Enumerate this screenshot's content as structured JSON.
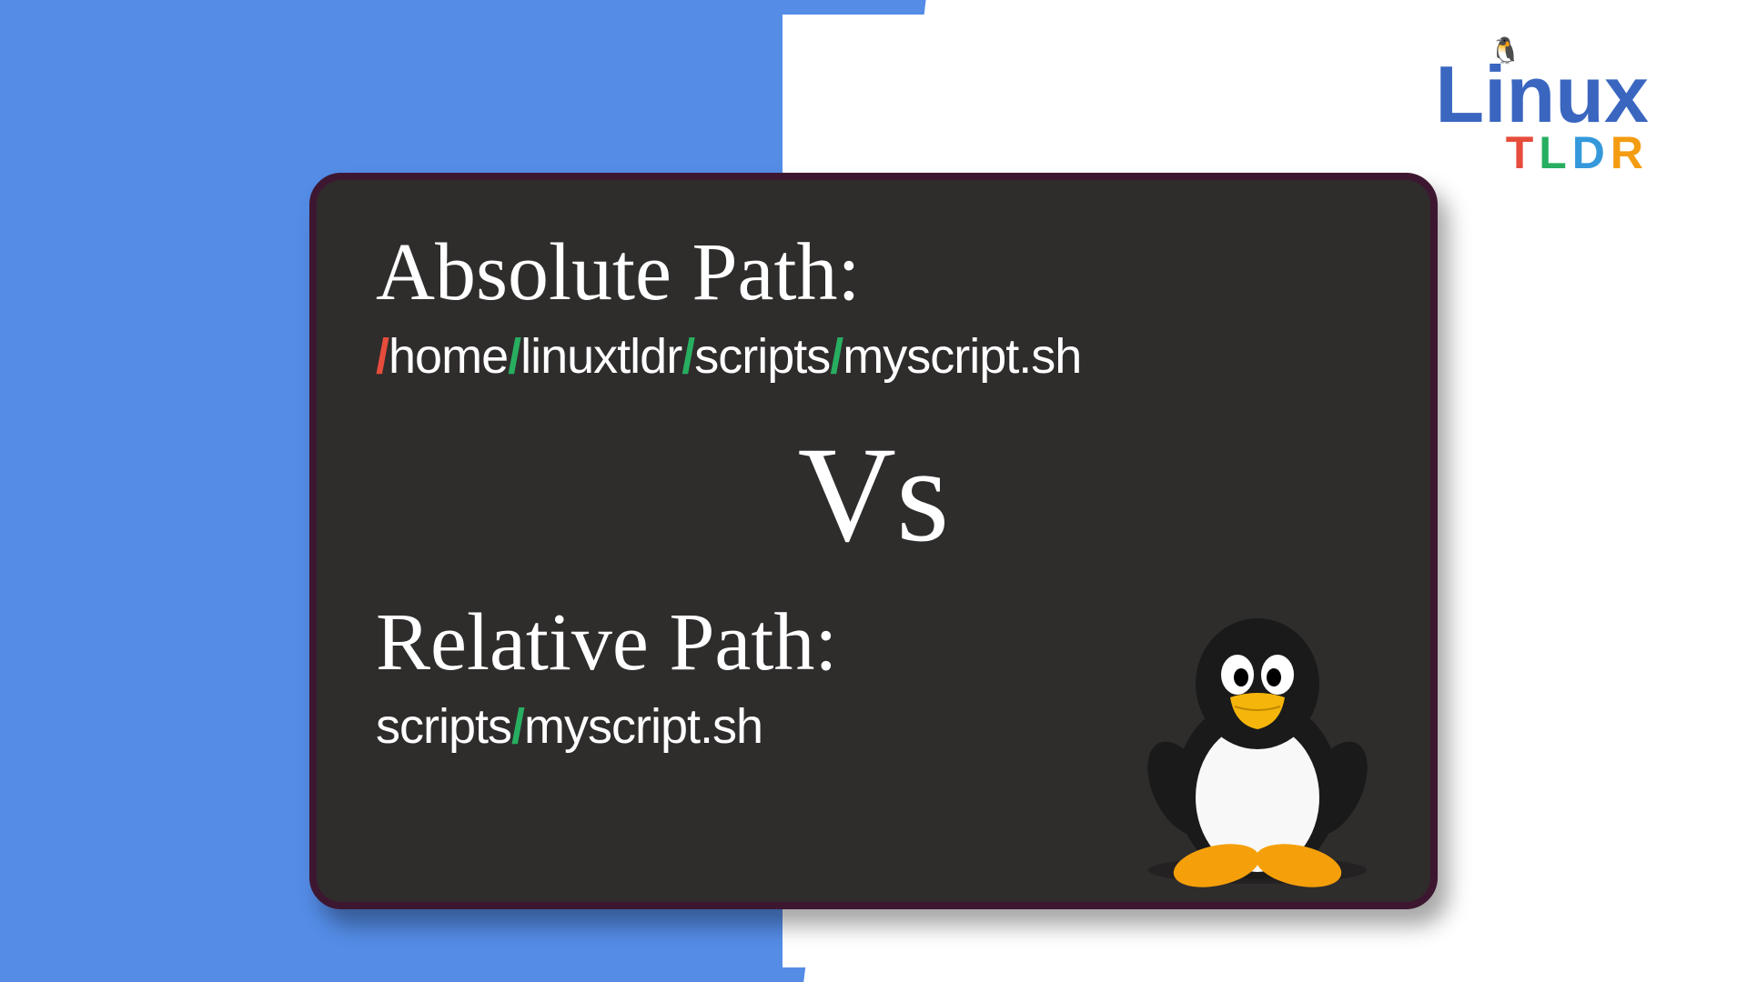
{
  "logo": {
    "brand": "Linux",
    "subtitle_t": "T",
    "subtitle_l": "L",
    "subtitle_d": "D",
    "subtitle_r": "R"
  },
  "card": {
    "absolute_heading": "Absolute Path:",
    "absolute_path": {
      "slash1": "/",
      "seg1": "home",
      "slash2": "/",
      "seg2": "linuxtldr",
      "slash3": "/",
      "seg3": "scripts",
      "slash4": "/",
      "seg4": "myscript.sh"
    },
    "vs": "Vs",
    "relative_heading": "Relative Path:",
    "relative_path": {
      "seg1": "scripts",
      "slash1": "/",
      "seg2": "myscript.sh"
    }
  }
}
